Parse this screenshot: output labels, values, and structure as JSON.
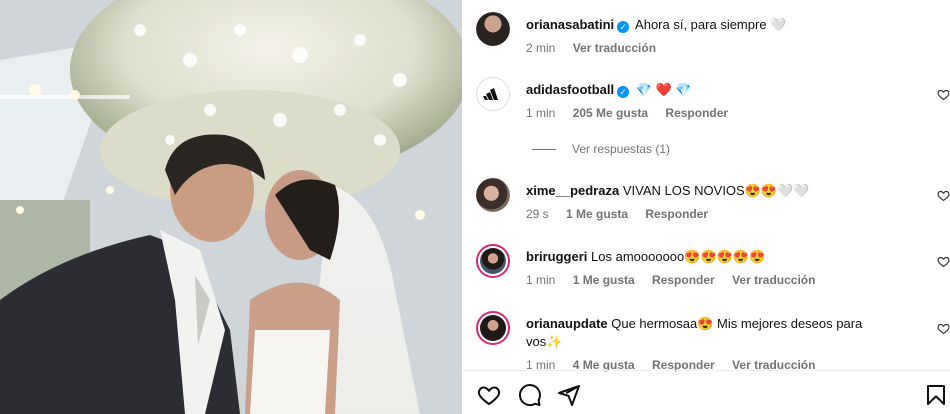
{
  "post": {
    "author": "orianasabatini",
    "caption": "Ahora sí, para siempre 🤍",
    "time": "2 min",
    "translate": "Ver traducción"
  },
  "comments": [
    {
      "user": "adidasfootball",
      "verified": true,
      "text": "💎 ❤️ 💎",
      "time": "1 min",
      "likes": "205 Me gusta",
      "reply": "Responder"
    },
    {
      "user": "xime__pedraza",
      "verified": false,
      "text": "VIVAN LOS NOVIOS😍😍🤍🤍",
      "time": "29 s",
      "likes": "1 Me gusta",
      "reply": "Responder"
    },
    {
      "user": "briruggeri",
      "verified": false,
      "text": "Los amooooooo😍😍😍😍😍",
      "time": "1 min",
      "likes": "1 Me gusta",
      "reply": "Responder",
      "translate": "Ver traducción"
    },
    {
      "user": "orianaupdate",
      "verified": false,
      "text": "Que hermosaa😍  Mis mejores deseos para vos✨",
      "time": "1 min",
      "likes": "4 Me gusta",
      "reply": "Responder",
      "translate": "Ver traducción"
    }
  ],
  "replies_link": "Ver respuestas (1)",
  "icons": {
    "like": "heart-icon",
    "comment": "comment-icon",
    "share": "send-icon",
    "save": "bookmark-icon",
    "verified": "verified-badge-icon"
  },
  "colors": {
    "verified": "#0095f6",
    "muted": "#737373",
    "heart_red": "#ed4956"
  }
}
